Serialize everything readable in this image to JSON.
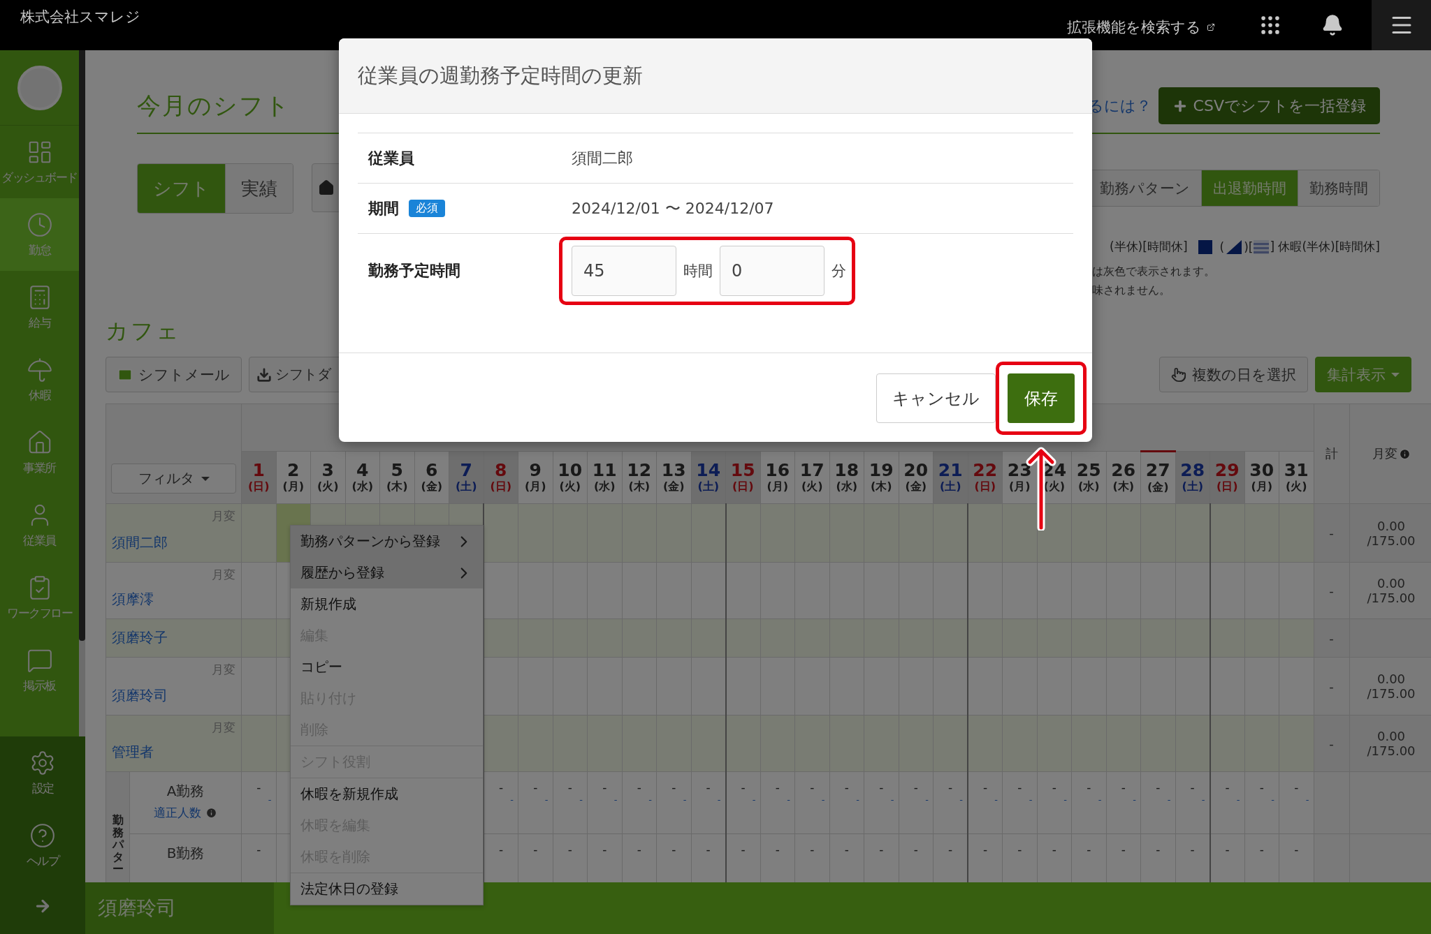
{
  "header": {
    "company": "株式会社スマレジ",
    "extension_link": "拡張機能を検索する"
  },
  "sidebar": {
    "items": [
      {
        "label": "ダッシュボード",
        "selected": false
      },
      {
        "label": "勤怠",
        "selected": true
      },
      {
        "label": "給与",
        "selected": false
      },
      {
        "label": "休暇",
        "selected": false
      },
      {
        "label": "事業所",
        "selected": false
      },
      {
        "label": "従業員",
        "selected": false
      },
      {
        "label": "ワークフロー",
        "selected": false
      },
      {
        "label": "掲示板",
        "selected": false
      }
    ],
    "bottom_items": [
      {
        "label": "設定"
      },
      {
        "label": "ヘルプ"
      }
    ]
  },
  "page": {
    "title": "今月のシフト",
    "help_link": "るには？",
    "csv_button": "CSVでシフトを一括登録",
    "mode_tabs": [
      {
        "label": "シフト",
        "selected": true
      },
      {
        "label": "実績",
        "selected": false
      }
    ],
    "view_tabs": [
      {
        "label": "勤務パターン",
        "selected": false
      },
      {
        "label": "出退勤時間",
        "selected": true
      },
      {
        "label": "勤務時間",
        "selected": false
      }
    ],
    "legend": [
      {
        "kind": "text",
        "text": "(半休)[時間休]"
      },
      {
        "kind": "square"
      },
      {
        "kind": "text",
        "text": "("
      },
      {
        "kind": "triangle"
      },
      {
        "kind": "text",
        "text": ")["
      },
      {
        "kind": "stripes"
      },
      {
        "kind": "text",
        "text": "] 休暇(半休)[時間休]"
      }
    ],
    "notes": [
      "は灰色で表示されます。",
      "味されません。"
    ]
  },
  "section": {
    "title": "カフェ",
    "mail_button": "シフトメール",
    "download_button": "シフトダ",
    "select_days_button": "複数の日を選択",
    "summary_button": "集計表示"
  },
  "table": {
    "filter": "フィルタ",
    "total_header": "計",
    "monthly_header": "月変",
    "days": [
      {
        "day": "1",
        "weekday": "(日)",
        "kind": "sun",
        "today": false
      },
      {
        "day": "2",
        "weekday": "(月)",
        "kind": "weekday",
        "today": false
      },
      {
        "day": "3",
        "weekday": "(火)",
        "kind": "weekday",
        "today": false
      },
      {
        "day": "4",
        "weekday": "(水)",
        "kind": "weekday",
        "today": false
      },
      {
        "day": "5",
        "weekday": "(木)",
        "kind": "weekday",
        "today": false
      },
      {
        "day": "6",
        "weekday": "(金)",
        "kind": "weekday",
        "today": false
      },
      {
        "day": "7",
        "weekday": "(土)",
        "kind": "sat",
        "today": false
      },
      {
        "day": "8",
        "weekday": "(日)",
        "kind": "sun",
        "today": false
      },
      {
        "day": "9",
        "weekday": "(月)",
        "kind": "weekday",
        "today": false
      },
      {
        "day": "10",
        "weekday": "(火)",
        "kind": "weekday",
        "today": false
      },
      {
        "day": "11",
        "weekday": "(水)",
        "kind": "weekday",
        "today": false
      },
      {
        "day": "12",
        "weekday": "(木)",
        "kind": "weekday",
        "today": false
      },
      {
        "day": "13",
        "weekday": "(金)",
        "kind": "weekday",
        "today": false
      },
      {
        "day": "14",
        "weekday": "(土)",
        "kind": "sat",
        "today": false
      },
      {
        "day": "15",
        "weekday": "(日)",
        "kind": "sun",
        "today": false
      },
      {
        "day": "16",
        "weekday": "(月)",
        "kind": "weekday",
        "today": false
      },
      {
        "day": "17",
        "weekday": "(火)",
        "kind": "weekday",
        "today": false
      },
      {
        "day": "18",
        "weekday": "(水)",
        "kind": "weekday",
        "today": false
      },
      {
        "day": "19",
        "weekday": "(木)",
        "kind": "weekday",
        "today": false
      },
      {
        "day": "20",
        "weekday": "(金)",
        "kind": "weekday",
        "today": false
      },
      {
        "day": "21",
        "weekday": "(土)",
        "kind": "sat",
        "today": false
      },
      {
        "day": "22",
        "weekday": "(日)",
        "kind": "sun",
        "today": false
      },
      {
        "day": "23",
        "weekday": "(月)",
        "kind": "weekday",
        "today": false
      },
      {
        "day": "24",
        "weekday": "(火)",
        "kind": "weekday",
        "today": false
      },
      {
        "day": "25",
        "weekday": "(水)",
        "kind": "weekday",
        "today": false
      },
      {
        "day": "26",
        "weekday": "(木)",
        "kind": "weekday",
        "today": false
      },
      {
        "day": "27",
        "weekday": "(金)",
        "kind": "weekday",
        "today": true
      },
      {
        "day": "28",
        "weekday": "(土)",
        "kind": "sat",
        "today": false
      },
      {
        "day": "29",
        "weekday": "(日)",
        "kind": "sun",
        "today": false
      },
      {
        "day": "30",
        "weekday": "(月)",
        "kind": "weekday",
        "today": false
      },
      {
        "day": "31",
        "weekday": "(火)",
        "kind": "weekday",
        "today": false
      }
    ],
    "employees": [
      {
        "name": "須間二郎",
        "badge": "月変",
        "total": "-",
        "monthly": "0.00\n/175.00",
        "cells": [
          {
            "selected": false
          },
          {
            "selected": true
          },
          {
            "selected": false
          },
          {
            "selected": false
          },
          {
            "selected": false
          },
          {
            "selected": false
          },
          {
            "selected": false
          },
          {
            "selected": false
          },
          {
            "selected": false
          },
          {
            "selected": false
          },
          {
            "selected": false
          },
          {
            "selected": false
          },
          {
            "selected": false
          },
          {
            "selected": false
          },
          {
            "selected": false
          },
          {
            "selected": false
          },
          {
            "selected": false
          },
          {
            "selected": false
          },
          {
            "selected": false
          },
          {
            "selected": false
          },
          {
            "selected": false
          },
          {
            "selected": false
          },
          {
            "selected": false
          },
          {
            "selected": false
          },
          {
            "selected": false
          },
          {
            "selected": false
          },
          {
            "selected": false
          },
          {
            "selected": false
          },
          {
            "selected": false
          },
          {
            "selected": false
          },
          {
            "selected": false
          }
        ]
      },
      {
        "name": "須摩澪",
        "badge": "月変",
        "total": "-",
        "monthly": "0.00\n/175.00",
        "cells": [
          {
            "selected": false
          },
          {
            "selected": false
          },
          null,
          null,
          null,
          null,
          null,
          {
            "selected": false
          },
          {
            "selected": false
          },
          {
            "selected": false
          },
          {
            "selected": false
          },
          {
            "selected": false
          },
          {
            "selected": false
          },
          {
            "selected": false
          },
          {
            "selected": false
          },
          {
            "selected": false
          },
          {
            "selected": false
          },
          {
            "selected": false
          },
          {
            "selected": false
          },
          {
            "selected": false
          },
          {
            "selected": false
          },
          {
            "selected": false
          },
          {
            "selected": false
          },
          {
            "selected": false
          },
          {
            "selected": false
          },
          {
            "selected": false
          },
          {
            "selected": false
          },
          {
            "selected": false
          },
          {
            "selected": false
          },
          {
            "selected": false
          },
          {
            "selected": false
          }
        ]
      },
      {
        "name": "須磨玲子",
        "total": "-",
        "cells": [
          {
            "selected": false
          },
          {
            "selected": false
          },
          null,
          null,
          null,
          null,
          null,
          {
            "selected": false
          },
          {
            "selected": false
          },
          {
            "selected": false
          },
          {
            "selected": false
          },
          {
            "selected": false
          },
          {
            "selected": false
          },
          {
            "selected": false
          },
          {
            "selected": false
          },
          {
            "selected": false
          },
          {
            "selected": false
          },
          {
            "selected": false
          },
          {
            "selected": false
          },
          {
            "selected": false
          },
          {
            "selected": false
          },
          {
            "selected": false
          },
          {
            "selected": false
          },
          {
            "selected": false
          },
          {
            "selected": false
          },
          {
            "selected": false
          },
          {
            "selected": false
          },
          {
            "selected": false
          },
          {
            "selected": false
          },
          {
            "selected": false
          },
          {
            "selected": false
          }
        ]
      },
      {
        "name": "須磨玲司",
        "badge": "月変",
        "total": "-",
        "monthly": "0.00\n/175.00",
        "cells": [
          {
            "selected": false
          },
          {
            "selected": false
          },
          null,
          null,
          null,
          null,
          null,
          {
            "selected": false
          },
          {
            "selected": false
          },
          {
            "selected": false
          },
          {
            "selected": false
          },
          {
            "selected": false
          },
          {
            "selected": false
          },
          {
            "selected": false
          },
          {
            "selected": false
          },
          {
            "selected": false
          },
          {
            "selected": false
          },
          {
            "selected": false
          },
          {
            "selected": false
          },
          {
            "selected": false
          },
          {
            "selected": false
          },
          {
            "selected": false
          },
          {
            "selected": false
          },
          {
            "selected": false
          },
          {
            "selected": false
          },
          {
            "selected": false
          },
          {
            "selected": false
          },
          {
            "selected": false
          },
          {
            "selected": false
          },
          {
            "selected": false
          },
          {
            "selected": false
          }
        ]
      },
      {
        "name": "管理者",
        "badge": "月変",
        "total": "-",
        "monthly": "0.00\n/175.00",
        "cells": [
          {
            "selected": false
          },
          {
            "selected": false
          },
          null,
          null,
          null,
          null,
          null,
          {
            "selected": false
          },
          {
            "selected": false
          },
          {
            "selected": false
          },
          {
            "selected": false
          },
          {
            "selected": false
          },
          {
            "selected": false
          },
          {
            "selected": false
          },
          {
            "selected": false
          },
          {
            "selected": false
          },
          {
            "selected": false
          },
          {
            "selected": false
          },
          {
            "selected": false
          },
          {
            "selected": false
          },
          {
            "selected": false
          },
          {
            "selected": false
          },
          {
            "selected": false
          },
          {
            "selected": false
          },
          {
            "selected": false
          },
          {
            "selected": false
          },
          {
            "selected": false
          },
          {
            "selected": false
          },
          {
            "selected": false
          },
          {
            "selected": false
          },
          {
            "selected": false
          }
        ]
      }
    ],
    "pattern_group": "勤務パター",
    "patterns": [
      {
        "name": "A勤務",
        "proper_label": "適正人数",
        "cells": [
          "-",
          null,
          null,
          null,
          null,
          null,
          null,
          "-",
          "-",
          "-",
          "-",
          "-",
          "-",
          "-",
          "-",
          "-",
          "-",
          "-",
          "-",
          "-",
          "-",
          "-",
          "-",
          "-",
          "-",
          "-",
          "-",
          "-",
          "-",
          "-",
          "-"
        ],
        "proper_cells": [
          "-",
          null,
          null,
          null,
          null,
          null,
          null,
          "-",
          "-",
          "-",
          "-",
          "-",
          "-",
          "-",
          "-",
          "-",
          "-",
          "-",
          "-",
          "-",
          "-",
          "-",
          "-",
          "-",
          "-",
          "-",
          "-",
          "-",
          "-",
          "-",
          "-"
        ]
      },
      {
        "name": "B勤務",
        "cells": [
          "-",
          null,
          null,
          null,
          null,
          null,
          null,
          "-",
          "-",
          "-",
          "-",
          "-",
          "-",
          "-",
          "-",
          "-",
          "-",
          "-",
          "-",
          "-",
          "-",
          "-",
          "-",
          "-",
          "-",
          "-",
          "-",
          "-",
          "-",
          "-",
          "-"
        ]
      }
    ]
  },
  "context_menu": {
    "items": [
      {
        "kind": "item",
        "label": "勤務パターンから登録",
        "submenu": true,
        "highlighted": true,
        "disabled": false
      },
      {
        "kind": "item",
        "label": "履歴から登録",
        "submenu": true,
        "highlighted": true,
        "disabled": false
      },
      {
        "kind": "item",
        "label": "新規作成",
        "submenu": false,
        "highlighted": false,
        "disabled": false
      },
      {
        "kind": "item",
        "label": "編集",
        "submenu": false,
        "highlighted": false,
        "disabled": true
      },
      {
        "kind": "item",
        "label": "コピー",
        "submenu": false,
        "highlighted": false,
        "disabled": false
      },
      {
        "kind": "item",
        "label": "貼り付け",
        "submenu": false,
        "highlighted": false,
        "disabled": true
      },
      {
        "kind": "item",
        "label": "削除",
        "submenu": false,
        "highlighted": false,
        "disabled": true
      },
      {
        "kind": "divider"
      },
      {
        "kind": "item",
        "label": "シフト役割",
        "submenu": false,
        "highlighted": false,
        "disabled": true
      },
      {
        "kind": "divider"
      },
      {
        "kind": "item",
        "label": "休暇を新規作成",
        "submenu": false,
        "highlighted": false,
        "disabled": false
      },
      {
        "kind": "item",
        "label": "休暇を編集",
        "submenu": false,
        "highlighted": false,
        "disabled": true
      },
      {
        "kind": "item",
        "label": "休暇を削除",
        "submenu": false,
        "highlighted": false,
        "disabled": true
      },
      {
        "kind": "divider"
      },
      {
        "kind": "item",
        "label": "法定休日の登録",
        "submenu": false,
        "highlighted": false,
        "disabled": false
      }
    ]
  },
  "bottom_bar": {
    "title": "須磨玲司"
  },
  "modal": {
    "title": "従業員の週勤務予定時間の更新",
    "rows": [
      {
        "kind": "text",
        "label": "従業員",
        "value": "須間二郎",
        "highlighted": false
      },
      {
        "kind": "text",
        "label": "期間",
        "required": "必須",
        "value": "2024/12/01 〜 2024/12/07",
        "highlighted": false
      },
      {
        "kind": "duration",
        "label": "勤務予定時間",
        "hours": "45",
        "hours_unit": "時間",
        "minutes": "0",
        "minutes_unit": "分",
        "highlighted": true
      }
    ],
    "cancel": "キャンセル",
    "save": "保存",
    "save_highlighted": true
  }
}
